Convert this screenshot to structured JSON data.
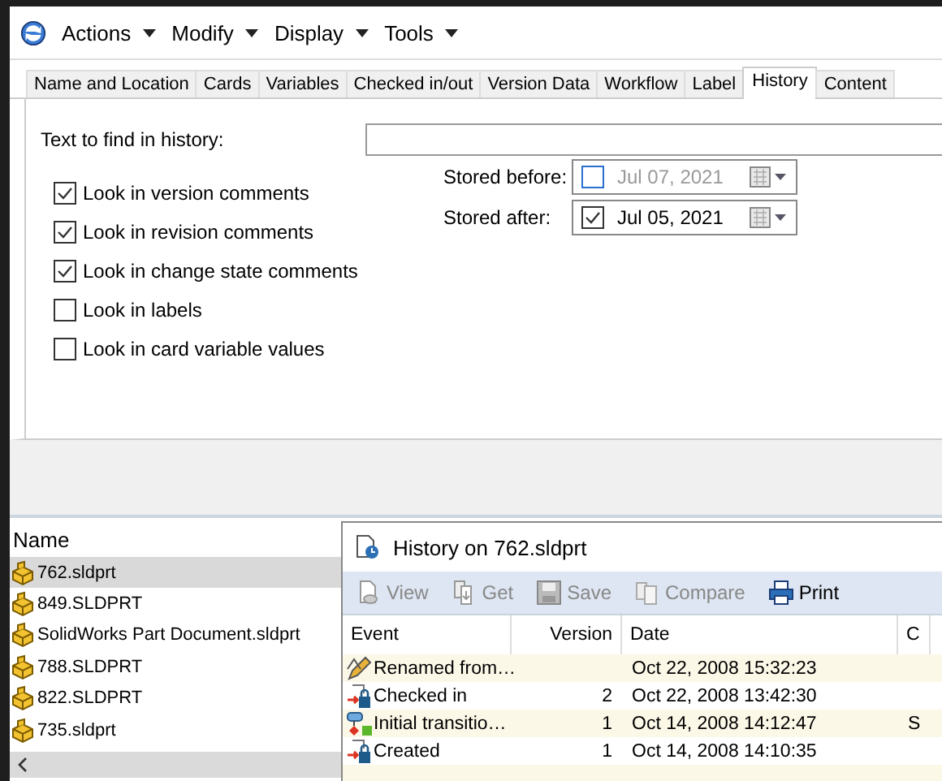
{
  "menu": [
    {
      "label": "Actions"
    },
    {
      "label": "Modify"
    },
    {
      "label": "Display"
    },
    {
      "label": "Tools"
    }
  ],
  "tabs": [
    {
      "label": "Name and Location",
      "selected": false
    },
    {
      "label": "Cards",
      "selected": false
    },
    {
      "label": "Variables",
      "selected": false
    },
    {
      "label": "Checked in/out",
      "selected": false
    },
    {
      "label": "Version Data",
      "selected": false
    },
    {
      "label": "Workflow",
      "selected": false
    },
    {
      "label": "Label",
      "selected": false
    },
    {
      "label": "History",
      "selected": true
    },
    {
      "label": "Content",
      "selected": false
    }
  ],
  "search": {
    "label": "Text to find in history:"
  },
  "options": [
    {
      "label": "Look in version comments",
      "checked": true
    },
    {
      "label": "Look in revision comments",
      "checked": true
    },
    {
      "label": "Look in change state comments",
      "checked": true
    },
    {
      "label": "Look in labels",
      "checked": false
    },
    {
      "label": "Look in card variable values",
      "checked": false
    }
  ],
  "dates": [
    {
      "label": "Stored before:",
      "checked": false,
      "value": "Jul  07, 2021"
    },
    {
      "label": "Stored after:",
      "checked": true,
      "value": "Jul  05, 2021"
    }
  ],
  "files": {
    "header": "Name",
    "items": [
      {
        "name": "762.sldprt",
        "selected": true
      },
      {
        "name": "849.SLDPRT",
        "selected": false
      },
      {
        "name": "SolidWorks Part Document.sldprt",
        "selected": false
      },
      {
        "name": "788.SLDPRT",
        "selected": false
      },
      {
        "name": "822.SLDPRT",
        "selected": false
      },
      {
        "name": "735.sldprt",
        "selected": false
      }
    ]
  },
  "history": {
    "title": "History on 762.sldprt",
    "toolbar": [
      {
        "label": "View",
        "kind": "view",
        "disabled": true
      },
      {
        "label": "Get",
        "kind": "get",
        "disabled": true
      },
      {
        "label": "Save",
        "kind": "save",
        "disabled": true
      },
      {
        "label": "Compare",
        "kind": "compare",
        "disabled": true
      },
      {
        "label": "Print",
        "kind": "print",
        "disabled": false
      }
    ],
    "columns": [
      "Event",
      "Version",
      "Date",
      "C"
    ],
    "rows": [
      {
        "kind": "rename",
        "event": "Renamed from…",
        "version": "",
        "date": "Oct 22, 2008 15:32:23",
        "column_4": ""
      },
      {
        "kind": "checkin",
        "event": "Checked in",
        "version": "2",
        "date": "Oct 22, 2008 13:42:30",
        "column_4": ""
      },
      {
        "kind": "transition",
        "event": "Initial transitio…",
        "version": "1",
        "date": "Oct 14, 2008 14:12:47",
        "column_4": "S"
      },
      {
        "kind": "checkin",
        "event": "Created",
        "version": "1",
        "date": "Oct 14, 2008 14:10:35",
        "column_4": ""
      }
    ]
  }
}
